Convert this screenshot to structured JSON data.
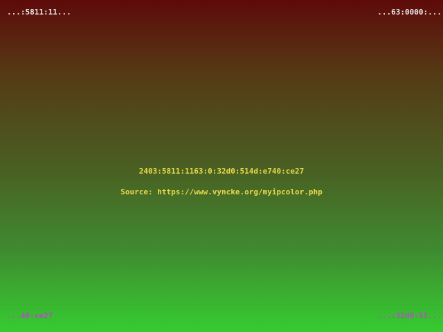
{
  "corners": {
    "top_left": "...:5811:11...",
    "top_right": "...63:0000:...",
    "bottom_left": "...40:ce27",
    "bottom_right": "...:32d0:51..."
  },
  "main": {
    "ip_address": "2403:5811:1163:0:32d0:514d:e740:ce27",
    "source_text": "Source: https://www.vyncke.org/myipcolor.php"
  },
  "colors": {
    "corner_top": "#e8e8e8",
    "corner_bottom": "#b94ac8",
    "center_text": "#e8d84a"
  }
}
